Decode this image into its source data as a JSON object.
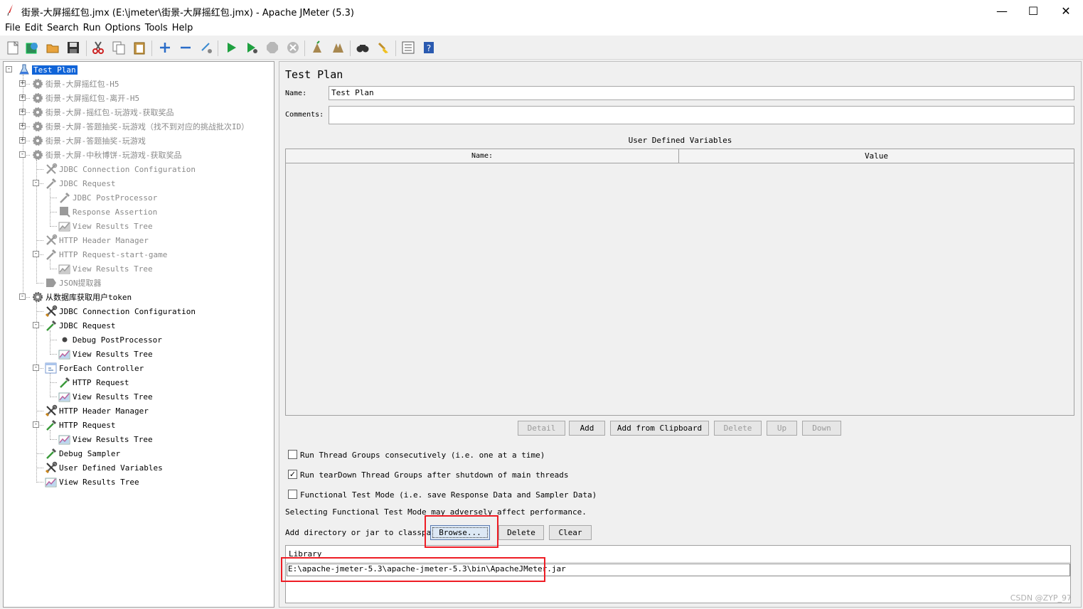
{
  "window": {
    "title": "街景-大屏摇红包.jmx (E:\\jmeter\\街景-大屏摇红包.jmx) - Apache JMeter (5.3)",
    "minimize": "—",
    "maximize": "☐",
    "close": "✕"
  },
  "menu": [
    "File",
    "Edit",
    "Search",
    "Run",
    "Options",
    "Tools",
    "Help"
  ],
  "toolbar": [
    {
      "name": "new-icon"
    },
    {
      "name": "templates-icon"
    },
    {
      "name": "open-icon"
    },
    {
      "name": "save-icon"
    },
    {
      "name": "cut-icon"
    },
    {
      "name": "copy-icon"
    },
    {
      "name": "paste-icon"
    },
    {
      "name": "expand-icon"
    },
    {
      "name": "collapse-icon"
    },
    {
      "name": "toggle-icon"
    },
    {
      "name": "start-icon"
    },
    {
      "name": "start-no-pause-icon"
    },
    {
      "name": "stop-icon"
    },
    {
      "name": "shutdown-icon"
    },
    {
      "name": "clear-icon"
    },
    {
      "name": "clear-all-icon"
    },
    {
      "name": "search-icon"
    },
    {
      "name": "reset-search-icon"
    },
    {
      "name": "function-helper-icon"
    },
    {
      "name": "help-icon"
    }
  ],
  "tree": [
    {
      "label": "Test Plan",
      "selected": true
    },
    {
      "label": "街景-大屏摇红包-H5",
      "disabled": true
    },
    {
      "label": "街景-大屏摇红包-离开-H5",
      "disabled": true
    },
    {
      "label": "街景-大屏-摇红包-玩游戏-获取奖品",
      "disabled": true
    },
    {
      "label": "街景-大屏-答题抽奖-玩游戏（找不到对应的挑战批次ID）",
      "disabled": true
    },
    {
      "label": "街景-大屏-答题抽奖-玩游戏",
      "disabled": true
    },
    {
      "label": "街景-大屏-中秋博饼-玩游戏-获取奖品",
      "disabled": true
    },
    {
      "label": "JDBC Connection Configuration",
      "disabled": true
    },
    {
      "label": "JDBC Request",
      "disabled": true
    },
    {
      "label": "JDBC PostProcessor",
      "disabled": true
    },
    {
      "label": "Response Assertion",
      "disabled": true
    },
    {
      "label": "View Results Tree",
      "disabled": true
    },
    {
      "label": "HTTP Header Manager",
      "disabled": true
    },
    {
      "label": "HTTP Request-start-game",
      "disabled": true
    },
    {
      "label": "View Results Tree",
      "disabled": true
    },
    {
      "label": "JSON提取器",
      "disabled": true
    },
    {
      "label": "从数据库获取用户token"
    },
    {
      "label": "JDBC Connection Configuration"
    },
    {
      "label": "JDBC Request"
    },
    {
      "label": "Debug PostProcessor"
    },
    {
      "label": "View Results Tree"
    },
    {
      "label": "ForEach Controller"
    },
    {
      "label": "HTTP Request"
    },
    {
      "label": "View Results Tree"
    },
    {
      "label": "HTTP Header Manager"
    },
    {
      "label": "HTTP Request"
    },
    {
      "label": "View Results Tree"
    },
    {
      "label": "Debug Sampler"
    },
    {
      "label": "User Defined Variables"
    },
    {
      "label": "View Results Tree"
    }
  ],
  "panel": {
    "title": "Test Plan",
    "name_label": "Name:",
    "name_value": "Test Plan",
    "comments_label": "Comments:",
    "comments_value": "",
    "udv_title": "User Defined Variables",
    "udv_col_name": "Name:",
    "udv_col_value": "Value",
    "buttons": [
      "Detail",
      "Add",
      "Add from Clipboard",
      "Delete",
      "Up",
      "Down"
    ],
    "chk_consecutive": "Run Thread Groups consecutively (i.e. one at a time)",
    "chk_teardown": "Run tearDown Thread Groups after shutdown of main threads",
    "chk_functional": "Functional Test Mode (i.e. save Response Data and Sampler Data)",
    "chk_consecutive_checked": false,
    "chk_teardown_checked": true,
    "chk_functional_checked": false,
    "functional_note": "Selecting Functional Test Mode may adversely affect performance.",
    "classpath_label": "Add directory or jar to classpath",
    "browse": "Browse...",
    "delete": "Delete",
    "clear": "Clear",
    "library_header": "Library",
    "library_entry": "E:\\apache-jmeter-5.3\\apache-jmeter-5.3\\bin\\ApacheJMeter.jar"
  },
  "watermark": "CSDN @ZYP_97"
}
